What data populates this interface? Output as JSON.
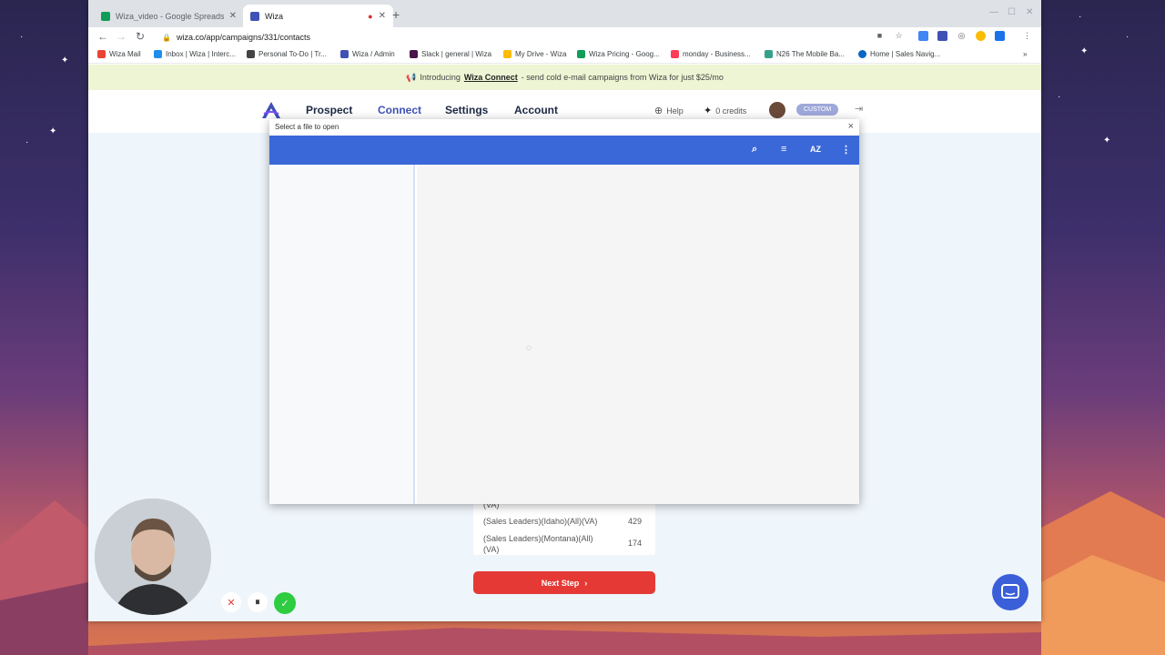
{
  "browser": {
    "tabs": [
      {
        "title": "Wiza_video - Google Spreadshe",
        "active": false,
        "favicon_color": "#0f9d58"
      },
      {
        "title": "Wiza",
        "active": true,
        "favicon_color": "#3f51b5"
      }
    ],
    "url": "wiza.co/app/campaigns/331/contacts",
    "bookmarks": [
      {
        "label": "Wiza Mail",
        "icon_color": "#ea4335"
      },
      {
        "label": "Inbox | Wiza | Interc...",
        "icon_color": "#1f8ded"
      },
      {
        "label": "Personal To-Do | Tr...",
        "icon_color": "#444444"
      },
      {
        "label": "Wiza / Admin",
        "icon_color": "#3f51b5"
      },
      {
        "label": "Slack | general | Wiza",
        "icon_color": "#4a154b"
      },
      {
        "label": "My Drive - Wiza",
        "icon_color": "#fbbc04"
      },
      {
        "label": "Wiza Pricing - Goog...",
        "icon_color": "#0f9d58"
      },
      {
        "label": "monday - Business...",
        "icon_color": "#ff3d57"
      },
      {
        "label": "N26 The Mobile Ba...",
        "icon_color": "#36a18b"
      },
      {
        "label": "Home | Sales Navig...",
        "icon_color": "#0a66c2"
      }
    ],
    "more_bookmarks": "»"
  },
  "banner": {
    "emoji": "📢",
    "prefix": "Introducing",
    "link": "Wiza Connect",
    "suffix": "- send cold e-mail campaigns from Wiza for just $25/mo"
  },
  "app": {
    "nav": [
      "Prospect",
      "Connect",
      "Settings",
      "Account"
    ],
    "active_nav": "Connect",
    "help": "Help",
    "credits": "0 credits",
    "plan": "CUSTOM"
  },
  "list": {
    "partial_item": "(VA)",
    "items": [
      {
        "name": "(Sales Leaders)(Idaho)(All)(VA)",
        "count": "429"
      },
      {
        "name": "(Sales Leaders)(Montana)(All)(VA)",
        "count": "174"
      }
    ],
    "next_button": "Next Step",
    "next_arrow": "›"
  },
  "picker": {
    "title": "Select a file to open",
    "close": "×"
  },
  "colors": {
    "accent": "#3f51b5",
    "picker_bar": "#3b68d8",
    "next_button": "#e53935",
    "banner_bg": "#eef5d4"
  }
}
